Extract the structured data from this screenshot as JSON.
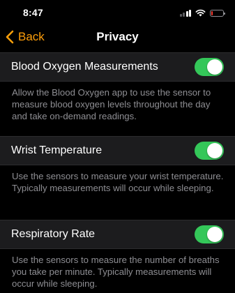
{
  "status_bar": {
    "time": "8:47",
    "signal_icon": "cellular-signal-icon",
    "wifi_icon": "wifi-icon",
    "battery_icon": "battery-icon",
    "battery_level": 0.1,
    "battery_color": "#ff3b30"
  },
  "nav": {
    "back_label": "Back",
    "title": "Privacy",
    "accent_color": "#ff9f0a"
  },
  "settings": [
    {
      "label": "Blood Oxygen Measurements",
      "enabled": true,
      "footer": "Allow the Blood Oxygen app to use the sensor to measure blood oxygen levels throughout the day and take on-demand readings."
    },
    {
      "label": "Wrist Temperature",
      "enabled": true,
      "footer": "Use the sensors to measure your wrist temperature. Typically measurements will occur while sleeping."
    },
    {
      "label": "Respiratory Rate",
      "enabled": true,
      "footer": "Use the sensors to measure the number of breaths you take per minute. Typically measurements will occur while sleeping."
    }
  ],
  "colors": {
    "toggle_on": "#34c759",
    "background": "#000000",
    "cell_background": "#1c1c1e",
    "footer_text": "#8e8e93"
  }
}
